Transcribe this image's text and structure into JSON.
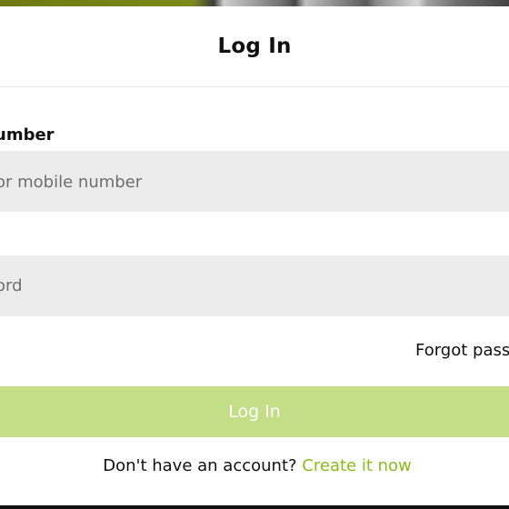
{
  "modal": {
    "title": "Log In"
  },
  "form": {
    "number_label": "umber",
    "username_placeholder": "or mobile number",
    "password_placeholder": "ord",
    "forgot_label": "Forgot passw",
    "login_label": "Log In"
  },
  "signup": {
    "prompt": "Don't have an account?",
    "link": "Create it now"
  },
  "colors": {
    "accent": "#8dba1f",
    "button_bg": "#c3de86",
    "input_bg": "#ececec"
  }
}
